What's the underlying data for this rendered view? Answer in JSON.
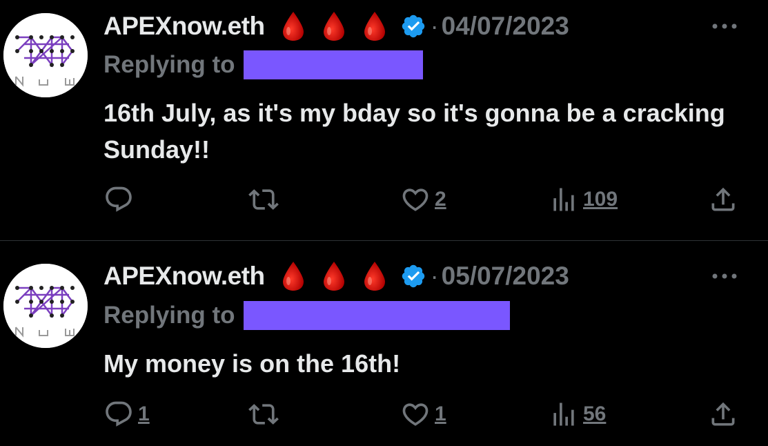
{
  "tweets": [
    {
      "author": "APEXnow.eth",
      "date": "04/07/2023",
      "replying_prefix": "Replying to",
      "text": "16th July, as it's my bday so it's gonna be a cracking Sunday!!",
      "counts": {
        "replies": "",
        "retweets": "",
        "likes": "2",
        "views": "109"
      }
    },
    {
      "author": "APEXnow.eth",
      "date": "05/07/2023",
      "replying_prefix": "Replying to",
      "text": "My money is on the 16th!",
      "counts": {
        "replies": "1",
        "retweets": "",
        "likes": "1",
        "views": "56"
      }
    }
  ],
  "separator": "·",
  "avatar_text": "NOW",
  "icons": {
    "blood_drop": "blood-drop-icon",
    "verified": "verified-badge-icon",
    "more": "more-icon",
    "reply": "reply-icon",
    "retweet": "retweet-icon",
    "like": "like-icon",
    "views": "views-icon",
    "share": "share-icon"
  },
  "colors": {
    "background": "#000000",
    "text": "#e7e9ea",
    "secondary": "#71767b",
    "verified": "#1d9bf0",
    "redaction": "#7a57ff",
    "drop": "#d40000",
    "avatar_accent": "#7b3fbf"
  }
}
